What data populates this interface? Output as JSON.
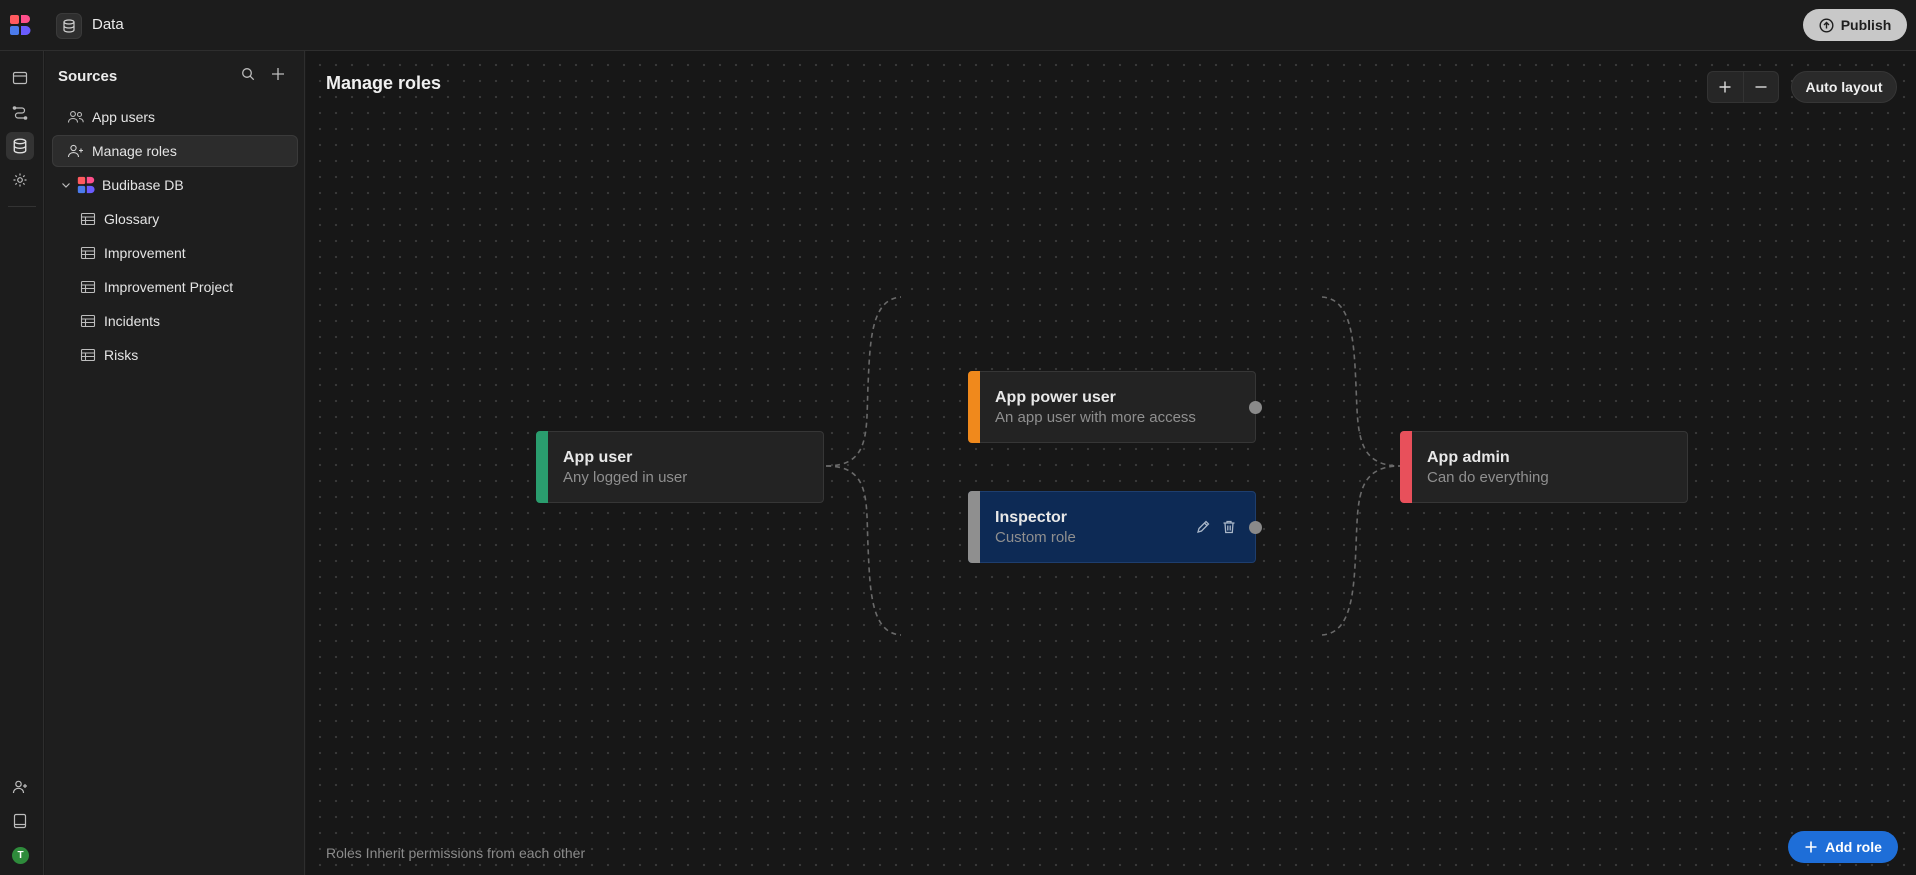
{
  "topbar": {
    "section_title": "Data",
    "publish_label": "Publish"
  },
  "sidebar": {
    "header": "Sources",
    "items": [
      {
        "label": "App users",
        "icon": "users-icon"
      },
      {
        "label": "Manage roles",
        "icon": "user-add-icon",
        "selected": true
      }
    ],
    "datasource": {
      "label": "Budibase DB",
      "tables": [
        "Glossary",
        "Improvement",
        "Improvement Project",
        "Incidents",
        "Risks"
      ]
    }
  },
  "canvas": {
    "title": "Manage roles",
    "auto_layout_label": "Auto layout",
    "footnote": "Roles Inherit permissions from each other",
    "add_role_label": "Add role",
    "roles": [
      {
        "name": "App user",
        "description": "Any logged in user",
        "color": "#2a9d6e"
      },
      {
        "name": "App power user",
        "description": "An app user with more access",
        "color": "#f0891c"
      },
      {
        "name": "Inspector",
        "description": "Custom role",
        "color": "#8f8f8f"
      },
      {
        "name": "App admin",
        "description": "Can do everything",
        "color": "#e8505b"
      }
    ]
  },
  "colors": {
    "accent": "#1e6ed8",
    "selected_node": "#0d2a55",
    "avatar": "#2e8b3b"
  },
  "avatar_letter": "T"
}
